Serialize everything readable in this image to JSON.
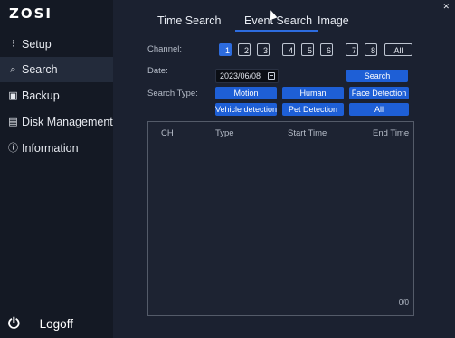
{
  "app": {
    "logo": "ZOSI"
  },
  "sidebar": {
    "items": [
      {
        "label": "Setup",
        "icon": "sliders-icon"
      },
      {
        "label": "Search",
        "icon": "search-icon"
      },
      {
        "label": "Backup",
        "icon": "floppy-icon"
      },
      {
        "label": "Disk Management",
        "icon": "disk-icon"
      },
      {
        "label": "Information",
        "icon": "info-icon"
      }
    ],
    "active": "Search",
    "logoff_label": "Logoff"
  },
  "tabs": [
    {
      "label": "Time Search"
    },
    {
      "label": "Event Search"
    },
    {
      "label": "Image"
    }
  ],
  "active_tab": "Event Search",
  "filters": {
    "channel_label": "Channel:",
    "channels": [
      "1",
      "2",
      "3",
      "4",
      "5",
      "6",
      "7",
      "8",
      "All"
    ],
    "selected_channel": "1",
    "date_label": "Date:",
    "date_value": "2023/06/08",
    "search_label": "Search",
    "search_type_label": "Search Type:",
    "search_types": [
      "Motion",
      "Human",
      "Face Detection",
      "Vehicle detection",
      "Pet Detection",
      "All"
    ]
  },
  "results": {
    "columns": [
      "CH",
      "Type",
      "Start Time",
      "End Time"
    ],
    "rows": [],
    "count_text": "0/0"
  },
  "colors": {
    "accent": "#2d6cdf",
    "button": "#1e5fd6",
    "background": "#1b2130",
    "sidebar": "#141924"
  }
}
